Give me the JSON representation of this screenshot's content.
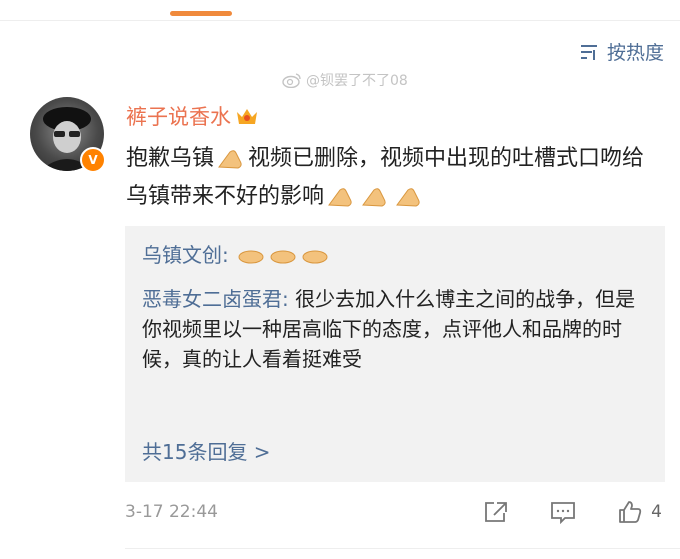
{
  "sort": {
    "label": "按热度",
    "icon": "sort-icon"
  },
  "watermark": {
    "text": "@钡罢了不了08",
    "icon": "weibo-logo-icon"
  },
  "comment": {
    "username": "裤子说香水",
    "badge": "V",
    "text_1": "抱歉乌镇",
    "text_2": "视频已删除，视频中出现的吐槽式口吻给乌镇带来不好的影响",
    "timestamp": "3-17 22:44",
    "like_count": "4"
  },
  "replies": [
    {
      "author": "乌镇文创",
      "separator": ":",
      "text": ""
    },
    {
      "author": "恶毒女二卤蛋君",
      "separator": ":",
      "text": "很少去加入什么博主之间的战争，但是你视频里以一种居高临下的态度，点评他人和品牌的时候，真的让人看着挺难受"
    }
  ],
  "replies_more": "共15条回复 >",
  "colors": {
    "accent": "#eb7350",
    "link": "#4f6e96",
    "tab": "#f08a3c",
    "badge": "#ff8200"
  }
}
